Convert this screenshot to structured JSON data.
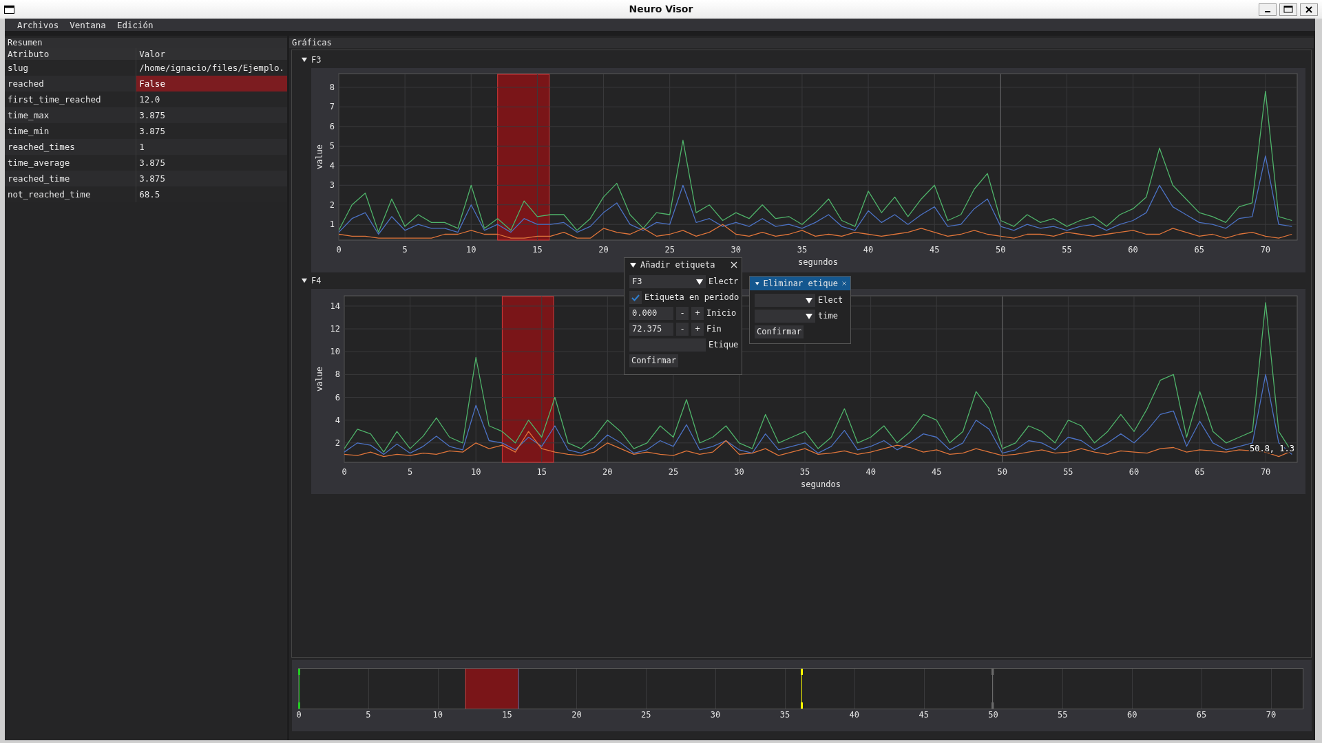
{
  "window": {
    "title": "Neuro Visor"
  },
  "menu": [
    "Archivos",
    "Ventana",
    "Edición"
  ],
  "summary": {
    "title": "Resumen",
    "columns": [
      "Atributo",
      "Valor"
    ],
    "rows": [
      {
        "attribute": "slug",
        "value": "/home/ignacio/files/Ejemplo.",
        "highlighted": false
      },
      {
        "attribute": "reached",
        "value": "False",
        "highlighted": true
      },
      {
        "attribute": "first_time_reached",
        "value": "12.0",
        "highlighted": false
      },
      {
        "attribute": "time_max",
        "value": "3.875",
        "highlighted": false
      },
      {
        "attribute": "time_min",
        "value": "3.875",
        "highlighted": false
      },
      {
        "attribute": "reached_times",
        "value": "1",
        "highlighted": false
      },
      {
        "attribute": "time_average",
        "value": "3.875",
        "highlighted": false
      },
      {
        "attribute": "reached_time",
        "value": "3.875",
        "highlighted": false
      },
      {
        "attribute": "not_reached_time",
        "value": "68.5",
        "highlighted": false
      }
    ]
  },
  "graphs": {
    "title": "Gráficas",
    "plots": [
      {
        "label": "F3",
        "expanded": true,
        "chart_data": {
          "type": "line",
          "xlabel": "segundos",
          "ylabel": "value",
          "xlim": [
            0,
            72.4
          ],
          "ylim": [
            0.2,
            8.7
          ],
          "xticks": [
            0,
            5,
            10,
            15,
            20,
            25,
            30,
            35,
            40,
            45,
            50,
            55,
            60,
            65,
            70
          ],
          "yticks": [
            1,
            2,
            3,
            4,
            5,
            6,
            7,
            8
          ],
          "x": [
            0,
            1,
            2,
            3,
            4,
            5,
            6,
            7,
            8,
            9,
            10,
            11,
            12,
            13,
            14,
            15,
            16,
            17,
            18,
            19,
            20,
            21,
            22,
            23,
            24,
            25,
            26,
            27,
            28,
            29,
            30,
            31,
            32,
            33,
            34,
            35,
            36,
            37,
            38,
            39,
            40,
            41,
            42,
            43,
            44,
            45,
            46,
            47,
            48,
            49,
            50,
            51,
            52,
            53,
            54,
            55,
            56,
            57,
            58,
            59,
            60,
            61,
            62,
            63,
            64,
            65,
            66,
            67,
            68,
            69,
            70,
            71,
            72
          ],
          "series": [
            {
              "color": "#4fb36a",
              "values": [
                0.7,
                2.0,
                2.6,
                0.6,
                2.3,
                0.9,
                1.5,
                1.1,
                1.1,
                0.8,
                3.0,
                0.8,
                1.3,
                0.7,
                2.2,
                1.4,
                1.5,
                1.5,
                0.7,
                1.3,
                2.4,
                3.1,
                1.5,
                0.8,
                1.6,
                1.5,
                5.3,
                1.6,
                2.0,
                1.2,
                1.6,
                1.3,
                2.0,
                1.3,
                1.4,
                1.0,
                1.6,
                2.3,
                1.2,
                0.9,
                2.7,
                1.6,
                2.4,
                1.4,
                2.3,
                3.0,
                1.2,
                1.5,
                2.8,
                3.6,
                1.2,
                0.9,
                1.5,
                1.1,
                1.3,
                0.9,
                1.2,
                1.4,
                0.9,
                1.5,
                1.8,
                2.4,
                4.9,
                3.0,
                2.3,
                1.6,
                1.4,
                1.1,
                1.9,
                2.1,
                7.8,
                1.4,
                1.2
              ]
            },
            {
              "color": "#4c72c4",
              "values": [
                0.6,
                1.3,
                1.6,
                0.5,
                1.4,
                0.7,
                1.0,
                0.8,
                0.8,
                0.6,
                2.0,
                0.7,
                1.0,
                0.6,
                1.3,
                1.0,
                1.0,
                1.1,
                0.6,
                0.9,
                1.6,
                2.1,
                1.0,
                0.7,
                1.1,
                1.0,
                3.0,
                1.1,
                1.3,
                0.9,
                1.1,
                0.9,
                1.3,
                0.9,
                1.0,
                0.8,
                1.1,
                1.5,
                0.9,
                0.7,
                1.7,
                1.1,
                1.5,
                1.0,
                1.5,
                1.9,
                0.9,
                1.0,
                1.8,
                2.3,
                0.9,
                0.7,
                1.0,
                0.8,
                0.9,
                0.7,
                0.9,
                1.0,
                0.7,
                1.0,
                1.2,
                1.6,
                3.0,
                1.9,
                1.5,
                1.1,
                1.0,
                0.8,
                1.3,
                1.4,
                4.5,
                1.0,
                0.9
              ]
            },
            {
              "color": "#e0753a",
              "values": [
                0.5,
                0.4,
                0.4,
                0.3,
                0.3,
                0.3,
                0.3,
                0.3,
                0.5,
                0.5,
                0.7,
                0.5,
                0.5,
                0.3,
                0.3,
                0.4,
                0.4,
                0.6,
                0.3,
                0.3,
                0.8,
                0.6,
                0.5,
                0.8,
                0.4,
                0.5,
                0.7,
                0.4,
                0.6,
                1.0,
                0.5,
                0.4,
                0.6,
                0.4,
                0.5,
                0.7,
                0.4,
                0.5,
                0.4,
                0.6,
                0.5,
                0.4,
                0.5,
                0.6,
                0.8,
                0.6,
                0.4,
                0.5,
                0.7,
                0.5,
                0.4,
                0.3,
                0.5,
                0.5,
                0.4,
                0.6,
                0.5,
                0.4,
                0.5,
                0.6,
                0.7,
                0.5,
                0.5,
                0.8,
                0.6,
                0.4,
                0.5,
                0.3,
                0.5,
                0.6,
                0.4,
                0.3,
                0.5
              ]
            }
          ],
          "grid": true,
          "bands": [
            {
              "axis": "x",
              "from": 12,
              "to": 15.9,
              "color": "#7a1518"
            }
          ],
          "ref_lines": [
            {
              "axis": "x",
              "value": 50,
              "color": "#6a6a6a"
            }
          ]
        }
      },
      {
        "label": "F4",
        "expanded": true,
        "hover_text": "50.8, 1.3",
        "chart_data": {
          "type": "line",
          "xlabel": "segundos",
          "ylabel": "value",
          "xlim": [
            0,
            72.4
          ],
          "ylim": [
            0.3,
            14.9
          ],
          "xticks": [
            0,
            5,
            10,
            15,
            20,
            25,
            30,
            35,
            40,
            45,
            50,
            55,
            60,
            65,
            70
          ],
          "yticks": [
            2,
            4,
            6,
            8,
            10,
            12,
            14
          ],
          "x": [
            0,
            1,
            2,
            3,
            4,
            5,
            6,
            7,
            8,
            9,
            10,
            11,
            12,
            13,
            14,
            15,
            16,
            17,
            18,
            19,
            20,
            21,
            22,
            23,
            24,
            25,
            26,
            27,
            28,
            29,
            30,
            31,
            32,
            33,
            34,
            35,
            36,
            37,
            38,
            39,
            40,
            41,
            42,
            43,
            44,
            45,
            46,
            47,
            48,
            49,
            50,
            51,
            52,
            53,
            54,
            55,
            56,
            57,
            58,
            59,
            60,
            61,
            62,
            63,
            64,
            65,
            66,
            67,
            68,
            69,
            70,
            71,
            72
          ],
          "series": [
            {
              "color": "#4fb36a",
              "values": [
                1.5,
                3.2,
                2.8,
                1.2,
                3.0,
                1.5,
                2.6,
                4.2,
                2.5,
                2.0,
                9.5,
                3.5,
                3.0,
                2.0,
                4.0,
                2.5,
                6.0,
                2.0,
                1.5,
                2.5,
                4.0,
                3.0,
                1.5,
                2.0,
                3.5,
                2.5,
                5.8,
                2.0,
                2.5,
                3.5,
                2.0,
                1.5,
                4.5,
                2.0,
                2.5,
                3.0,
                1.5,
                2.5,
                5.0,
                2.0,
                2.5,
                3.5,
                2.0,
                3.0,
                4.5,
                4.0,
                2.0,
                3.0,
                6.5,
                5.0,
                1.5,
                2.0,
                3.5,
                3.0,
                2.0,
                4.0,
                3.5,
                2.0,
                3.0,
                4.5,
                3.0,
                5.0,
                7.5,
                8.0,
                2.5,
                6.5,
                3.0,
                2.0,
                2.5,
                3.0,
                14.3,
                3.0,
                1.2
              ]
            },
            {
              "color": "#4c72c4",
              "values": [
                1.2,
                2.0,
                1.8,
                1.0,
                1.9,
                1.1,
                1.7,
                2.6,
                1.7,
                1.4,
                5.3,
                2.2,
                2.0,
                1.4,
                2.5,
                1.7,
                3.5,
                1.4,
                1.1,
                1.6,
                2.7,
                2.0,
                1.1,
                1.4,
                2.2,
                1.7,
                3.6,
                1.4,
                1.7,
                2.2,
                1.4,
                1.1,
                2.8,
                1.4,
                1.7,
                2.0,
                1.1,
                1.7,
                3.1,
                1.4,
                1.7,
                2.2,
                1.4,
                2.0,
                2.8,
                2.5,
                1.4,
                2.0,
                4.0,
                3.2,
                1.1,
                1.4,
                2.2,
                2.0,
                1.4,
                2.5,
                2.2,
                1.4,
                2.0,
                2.8,
                2.0,
                3.1,
                4.5,
                4.8,
                1.7,
                3.9,
                2.0,
                1.4,
                1.7,
                2.0,
                8.0,
                2.0,
                1.0
              ]
            },
            {
              "color": "#e0753a",
              "values": [
                1.0,
                0.9,
                1.2,
                0.8,
                1.0,
                0.9,
                1.1,
                1.0,
                1.3,
                1.2,
                2.0,
                1.5,
                1.8,
                1.2,
                3.0,
                1.5,
                1.2,
                1.0,
                0.9,
                1.2,
                2.0,
                1.5,
                1.0,
                1.2,
                1.0,
                0.9,
                1.3,
                1.0,
                1.2,
                2.2,
                1.0,
                1.1,
                1.5,
                0.9,
                1.2,
                1.5,
                1.0,
                1.1,
                1.3,
                1.0,
                1.2,
                1.5,
                1.8,
                1.6,
                1.2,
                1.4,
                1.0,
                1.1,
                1.5,
                1.2,
                0.9,
                1.0,
                1.2,
                1.4,
                1.1,
                1.2,
                1.5,
                1.2,
                1.0,
                1.3,
                1.2,
                1.1,
                1.5,
                1.6,
                1.2,
                1.4,
                1.3,
                1.2,
                1.4,
                1.3,
                1.2,
                0.8,
                1.3
              ]
            }
          ],
          "grid": true,
          "bands": [
            {
              "axis": "x",
              "from": 12,
              "to": 15.9,
              "color": "#7a1518"
            }
          ],
          "ref_lines": [
            {
              "axis": "x",
              "value": 50,
              "color": "#6a6a6a"
            }
          ]
        }
      }
    ]
  },
  "timeline": {
    "scale": [
      {
        "label": "0"
      },
      {
        "label": "5"
      },
      {
        "label": "10"
      },
      {
        "label": "15"
      },
      {
        "label": "20"
      },
      {
        "label": "25"
      },
      {
        "label": "30"
      },
      {
        "label": "35"
      },
      {
        "label": "40"
      },
      {
        "label": "45"
      },
      {
        "label": "50"
      },
      {
        "label": "55"
      },
      {
        "label": "60"
      },
      {
        "label": "65"
      },
      {
        "label": "70"
      }
    ],
    "range": {
      "color": "#7a1518",
      "start": {
        "level": 0.1657
      },
      "end": {
        "level": 0.2196
      }
    },
    "markers": [
      {
        "color": "#6a6a6a",
        "level": 0.6906
      },
      {
        "color": "#22cc22",
        "level": 0
      },
      {
        "color": "#ffff00",
        "level": 0.5007
      }
    ]
  },
  "add_label_dialog": {
    "title": "Añadir etiqueta",
    "active": false,
    "fields": [
      {
        "kind": "combo",
        "content": "F3",
        "label": "Electr"
      },
      {
        "kind": "checkbox",
        "checked": true,
        "label": "Etiqueta en periodo"
      },
      {
        "kind": "number",
        "content": "0.000",
        "decrement": "-",
        "increment": "+",
        "label": "Inicio"
      },
      {
        "kind": "number",
        "content": "72.375",
        "decrement": "-",
        "increment": "+",
        "label": "Fin"
      },
      {
        "kind": "text",
        "label": "Etique"
      }
    ],
    "confirm": "Confirmar"
  },
  "remove_label_dialog": {
    "title": "Eliminar etique",
    "active": true,
    "fields": [
      {
        "kind": "combo",
        "label": "Elect"
      },
      {
        "kind": "combo",
        "label": "time"
      }
    ],
    "confirm": "Confirmar"
  }
}
